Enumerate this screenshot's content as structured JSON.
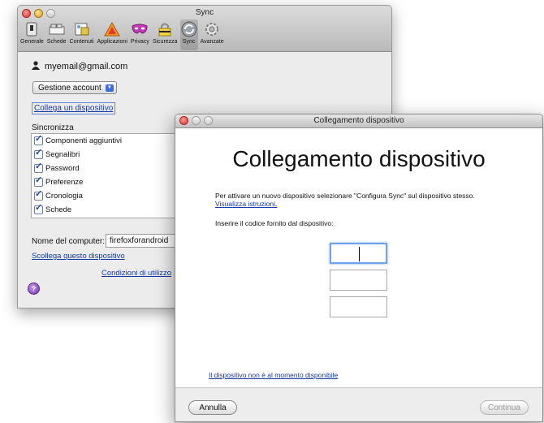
{
  "prefs_window": {
    "title": "Sync",
    "toolbar": [
      {
        "label": "Generale",
        "icon": "switch-icon"
      },
      {
        "label": "Schede",
        "icon": "tabs-icon"
      },
      {
        "label": "Contenuti",
        "icon": "contents-icon"
      },
      {
        "label": "Applicazioni",
        "icon": "applications-icon"
      },
      {
        "label": "Privacy",
        "icon": "mask-icon"
      },
      {
        "label": "Sicurezza",
        "icon": "lock-icon"
      },
      {
        "label": "Sync",
        "icon": "sync-icon"
      },
      {
        "label": "Avanzate",
        "icon": "gear-icon"
      }
    ],
    "account_email": "myemail@gmail.com",
    "manage_account": "Gestione account",
    "connect_device_link": "Collega un dispositivo",
    "sync_heading": "Sincronizza",
    "sync_items": [
      "Componenti aggiuntivi",
      "Segnalibri",
      "Password",
      "Preferenze",
      "Cronologia",
      "Schede"
    ],
    "computer_name_label": "Nome del computer:",
    "computer_name_value": "firefoxforandroid",
    "unlink_link": "Scollega questo dispositivo",
    "terms_link": "Condizioni di utilizzo",
    "help": "?"
  },
  "dialog": {
    "title": "Collegamento dispositivo",
    "heading": "Collegamento dispositivo",
    "instructions": "Per attivare un nuovo dispositivo selezionare \"Configura Sync\" sul dispositivo stesso.",
    "instructions_link": "Visualizza istruzioni.",
    "code_label": "Inserire il codice fornito dal dispositivo:",
    "code_fields": [
      "",
      "",
      ""
    ],
    "not_available_link": "Il dispositivo non è al momento disponibile",
    "cancel_label": "Annulla",
    "continue_label": "Continua"
  }
}
